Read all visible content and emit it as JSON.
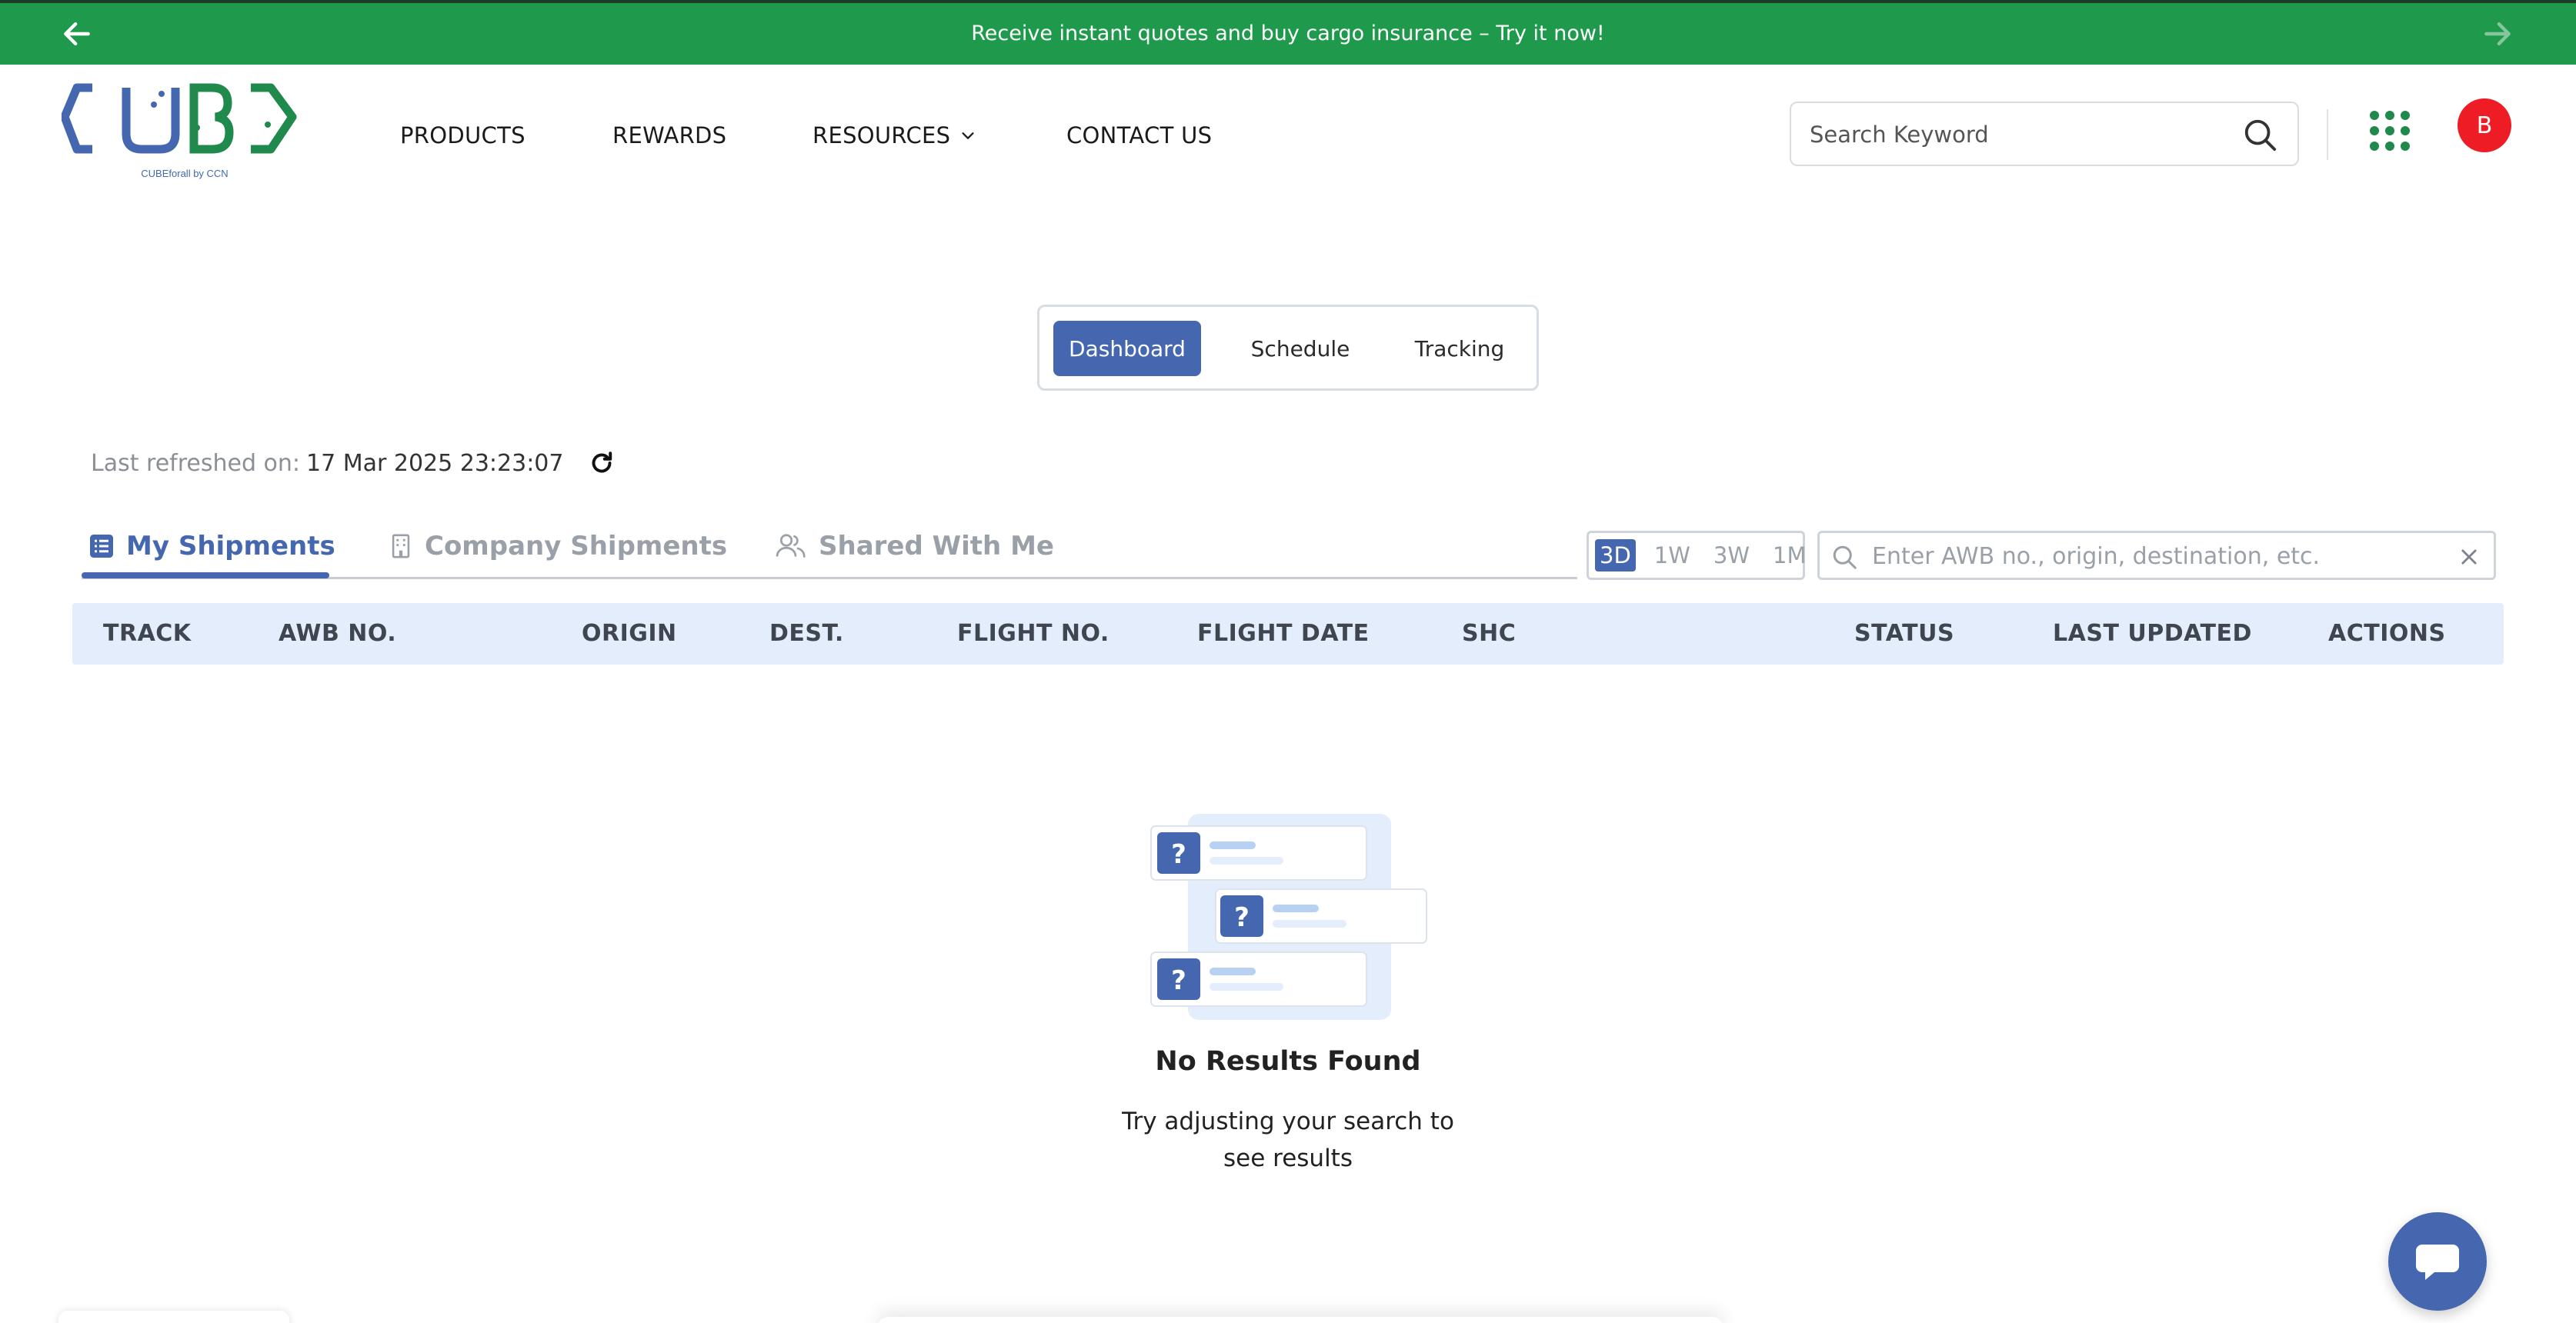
{
  "banner": {
    "text": "Receive instant quotes and buy cargo insurance – Try it now!",
    "background": "#1f9a4c"
  },
  "logo": {
    "text": "CUBE",
    "tagline": "CUBEforall by CCN",
    "colors": {
      "blue": "#4467b0",
      "green": "#1f8a4c"
    }
  },
  "nav": {
    "products": "PRODUCTS",
    "rewards": "REWARDS",
    "resources": "RESOURCES",
    "contact": "CONTACT US"
  },
  "header": {
    "search_placeholder": "Search Keyword",
    "avatar_initial": "B",
    "avatar_color": "#ee1c25"
  },
  "view_switch": {
    "dashboard": "Dashboard",
    "schedule": "Schedule",
    "tracking": "Tracking",
    "active": "Dashboard",
    "accent": "#4467b0"
  },
  "refresh": {
    "label": "Last refreshed on:",
    "value": "17 Mar 2025 23:23:07"
  },
  "tabs": {
    "my_shipments": "My Shipments",
    "company_shipments": "Company Shipments",
    "shared_with_me": "Shared With Me",
    "active": "My Shipments"
  },
  "period_filter": {
    "options": [
      "3D",
      "1W",
      "3W",
      "1M"
    ],
    "selected": "3D"
  },
  "table_search": {
    "placeholder": "Enter AWB no., origin, destination, etc."
  },
  "table": {
    "columns": [
      "TRACK",
      "AWB NO.",
      "ORIGIN",
      "DEST.",
      "FLIGHT NO.",
      "FLIGHT DATE",
      "SHC",
      "STATUS",
      "LAST UPDATED",
      "ACTIONS"
    ],
    "rows": []
  },
  "empty_state": {
    "title": "No Results Found",
    "subtitle": "Try adjusting your search to see results"
  }
}
